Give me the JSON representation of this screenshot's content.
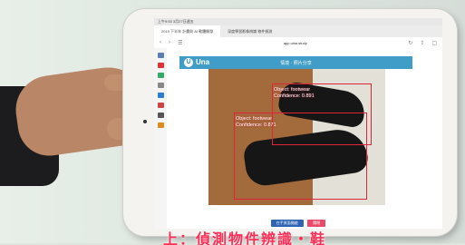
{
  "browser": {
    "status_text": "上午9:53 3月27日週五",
    "tabs": [
      "2019 下半年 計畫與 AI 軟體開發",
      "深度學習影像辨識 物件偵測",
      "app.uina.study"
    ],
    "url": "app.uina.study"
  },
  "app": {
    "logo_letter": "U",
    "brand": "Una",
    "page_title": "情境 · 照片分享",
    "accent_color": "#3f9dc7"
  },
  "detections": [
    {
      "line1": "Object: footwear",
      "line2": "Confidence: 0.891"
    },
    {
      "line1": "Object: footwear",
      "line2": "Confidence: 0.871"
    }
  ],
  "buttons": {
    "primary": "在手頁面開啟",
    "secondary": "關閉",
    "primary_color": "#2f64b4",
    "secondary_color": "#e94a6a"
  },
  "caption": "上：偵測物件辨識・鞋"
}
